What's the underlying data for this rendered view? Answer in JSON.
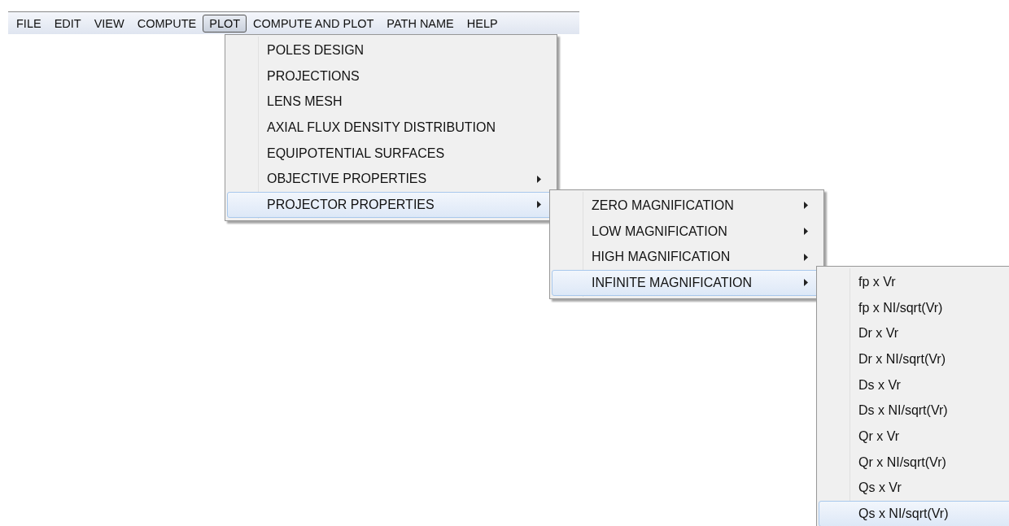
{
  "menubar": {
    "items": [
      {
        "label": "FILE",
        "selected": false
      },
      {
        "label": "EDIT",
        "selected": false
      },
      {
        "label": "VIEW",
        "selected": false
      },
      {
        "label": "COMPUTE",
        "selected": false
      },
      {
        "label": "PLOT",
        "selected": true
      },
      {
        "label": "COMPUTE AND PLOT",
        "selected": false
      },
      {
        "label": "PATH NAME",
        "selected": false
      },
      {
        "label": "HELP",
        "selected": false
      }
    ]
  },
  "menus": [
    {
      "items": [
        {
          "label": "POLES DESIGN",
          "submenu": false,
          "selected": false
        },
        {
          "label": "PROJECTIONS",
          "submenu": false,
          "selected": false
        },
        {
          "label": "LENS MESH",
          "submenu": false,
          "selected": false
        },
        {
          "label": "AXIAL FLUX DENSITY DISTRIBUTION",
          "submenu": false,
          "selected": false
        },
        {
          "label": "EQUIPOTENTIAL SURFACES",
          "submenu": false,
          "selected": false
        },
        {
          "label": "OBJECTIVE PROPERTIES",
          "submenu": true,
          "selected": false
        },
        {
          "label": "PROJECTOR PROPERTIES",
          "submenu": true,
          "selected": true
        }
      ]
    },
    {
      "items": [
        {
          "label": "ZERO MAGNIFICATION",
          "submenu": true,
          "selected": false
        },
        {
          "label": "LOW MAGNIFICATION",
          "submenu": true,
          "selected": false
        },
        {
          "label": "HIGH MAGNIFICATION",
          "submenu": true,
          "selected": false
        },
        {
          "label": "INFINITE MAGNIFICATION",
          "submenu": true,
          "selected": true
        }
      ]
    },
    {
      "items": [
        {
          "label": "fp x Vr",
          "submenu": false,
          "selected": false
        },
        {
          "label": "fp x NI/sqrt(Vr)",
          "submenu": false,
          "selected": false
        },
        {
          "label": "Dr x Vr",
          "submenu": false,
          "selected": false
        },
        {
          "label": "Dr x NI/sqrt(Vr)",
          "submenu": false,
          "selected": false
        },
        {
          "label": "Ds x Vr",
          "submenu": false,
          "selected": false
        },
        {
          "label": "Ds x NI/sqrt(Vr)",
          "submenu": false,
          "selected": false
        },
        {
          "label": "Qr x Vr",
          "submenu": false,
          "selected": false
        },
        {
          "label": "Qr x NI/sqrt(Vr)",
          "submenu": false,
          "selected": false
        },
        {
          "label": "Qs x Vr",
          "submenu": false,
          "selected": false
        },
        {
          "label": "Qs x NI/sqrt(Vr)",
          "submenu": false,
          "selected": true
        }
      ]
    }
  ]
}
